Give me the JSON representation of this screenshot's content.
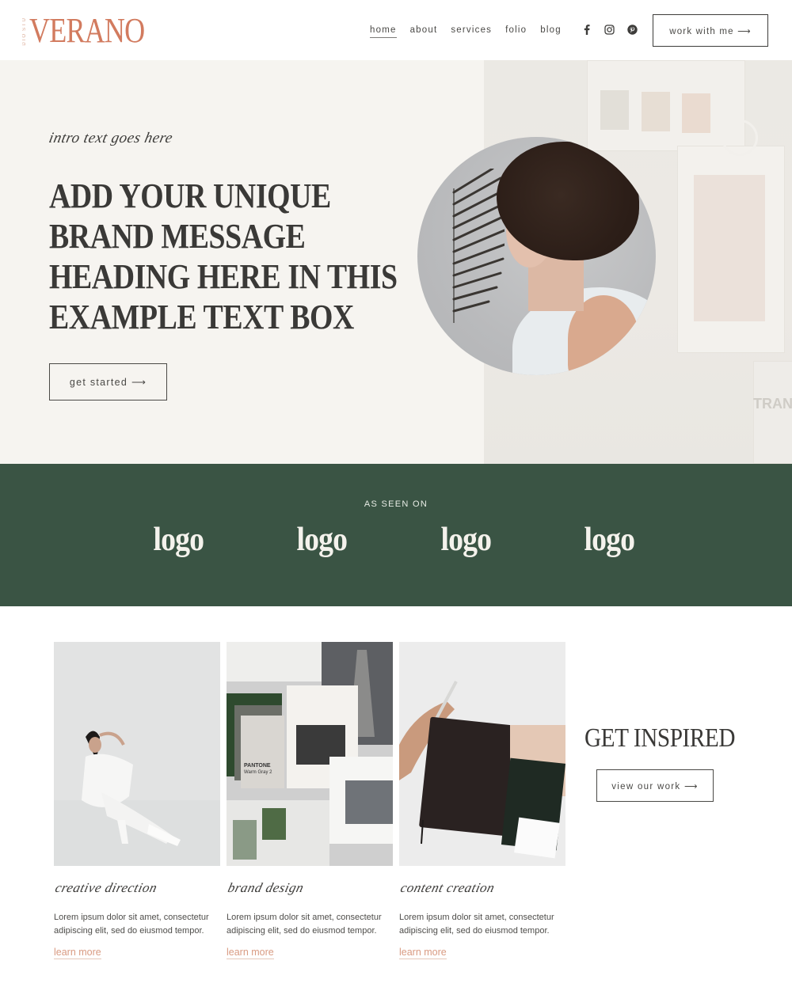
{
  "header": {
    "logo_small_top": "STU",
    "logo_small_bottom": "DIO",
    "logo_main": "VERANO",
    "nav": [
      {
        "label": "home",
        "active": true
      },
      {
        "label": "about",
        "active": false
      },
      {
        "label": "services",
        "active": false
      },
      {
        "label": "folio",
        "active": false
      },
      {
        "label": "blog",
        "active": false
      }
    ],
    "social": [
      "facebook-icon",
      "instagram-icon",
      "pinterest-icon"
    ],
    "cta_label": "work with me ⟶"
  },
  "hero": {
    "intro": "intro text goes here",
    "title_lines": [
      "ADD YOUR UNIQUE",
      "BRAND MESSAGE",
      "HEADING HERE IN THIS",
      "EXAMPLE TEXT BOX"
    ],
    "button_label": "get started ⟶",
    "bg_text": "TRANS"
  },
  "seen_on": {
    "label": "AS SEEN ON",
    "logos": [
      "logo",
      "logo",
      "logo",
      "logo"
    ]
  },
  "services": [
    {
      "title": "creative direction",
      "body": "Lorem ipsum dolor sit amet, consectetur adipiscing elit, sed do eiusmod tempor.",
      "link": "learn more"
    },
    {
      "title": "brand design",
      "body": "Lorem ipsum dolor sit amet, consectetur adipiscing elit, sed do eiusmod tempor.",
      "link": "learn more",
      "image_text_1": "PANTONE",
      "image_text_2": "Warm Gray 2"
    },
    {
      "title": "content creation",
      "body": "Lorem ipsum dolor sit amet, consectetur adipiscing elit, sed do eiusmod tempor.",
      "link": "learn more"
    }
  ],
  "inspired": {
    "heading": "GET INSPIRED",
    "button_label": "view our work ⟶"
  },
  "colors": {
    "brand_coral": "#d27b5f",
    "green_band": "#3a5444",
    "hero_bg": "#f6f4f0",
    "link_color": "#d99b82"
  }
}
